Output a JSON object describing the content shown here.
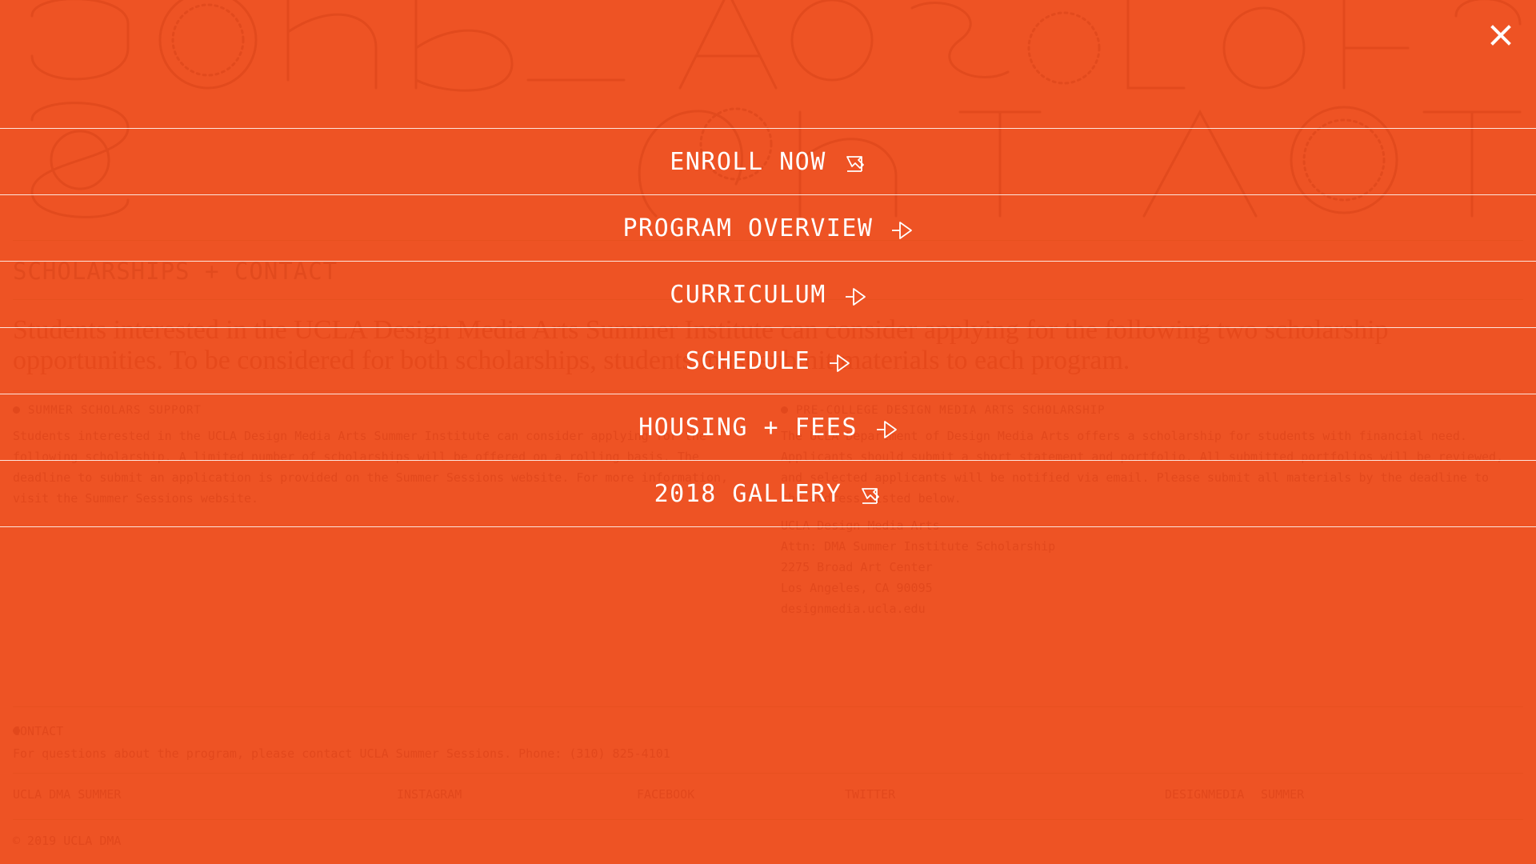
{
  "background": {
    "section_title": "SCHOLARSHIPS + CONTACT",
    "intro": "Students interested in the UCLA Design Media Arts Summer Institute can consider applying for the following two scholarship opportunities. To be considered for both scholarships, students must submit materials to each program.",
    "left_heading": "SUMMER SCHOLARS SUPPORT",
    "left_text": "Students interested in the UCLA Design Media Arts Summer Institute can consider applying for the following scholarship. A limited number of scholarships will be offered on a rolling basis. The deadline to submit an application is provided on the Summer Sessions website. For more information, visit the Summer Sessions website.",
    "right_heading": "PRE-COLLEGE DESIGN MEDIA ARTS SCHOLARSHIP",
    "right_text": "The UCLA Department of Design Media Arts offers a scholarship for students with financial need. Applicants should submit a short statement and portfolio. All submitted portfolios will be reviewed, and selected applicants will be notified via email. Please submit all materials by the deadline to the address listed below.",
    "right_list": [
      "UCLA Design Media Arts",
      "Attn: DMA Summer Institute Scholarship",
      "2275 Broad Art Center",
      "Los Angeles, CA 90095",
      "designmedia.ucla.edu"
    ],
    "contact_heading": "CONTACT",
    "contact_text": "For questions about the program, please contact UCLA Summer Sessions. Phone: (310) 825-4101",
    "footer": [
      "UCLA DMA SUMMER",
      "INSTAGRAM",
      "FACEBOOK",
      "TWITTER",
      "DESIGNMEDIA",
      "SUMMER"
    ],
    "copyright": "© 2019 UCLA DMA"
  },
  "close_button": {
    "icon": "close-icon",
    "color": "#ffffff"
  },
  "menu": {
    "items": [
      {
        "label": "ENROLL NOW",
        "icon": "external-link-arrow-icon"
      },
      {
        "label": "PROGRAM OVERVIEW",
        "icon": "arrow-right-icon"
      },
      {
        "label": "CURRICULUM",
        "icon": "arrow-right-icon"
      },
      {
        "label": "SCHEDULE",
        "icon": "arrow-right-icon"
      },
      {
        "label": "HOUSING + FEES",
        "icon": "arrow-right-icon"
      },
      {
        "label": "2018 GALLERY",
        "icon": "external-link-arrow-icon"
      }
    ]
  },
  "colors": {
    "accent": "#ee5324",
    "text": "#ffffff",
    "divider": "#ffffff"
  }
}
